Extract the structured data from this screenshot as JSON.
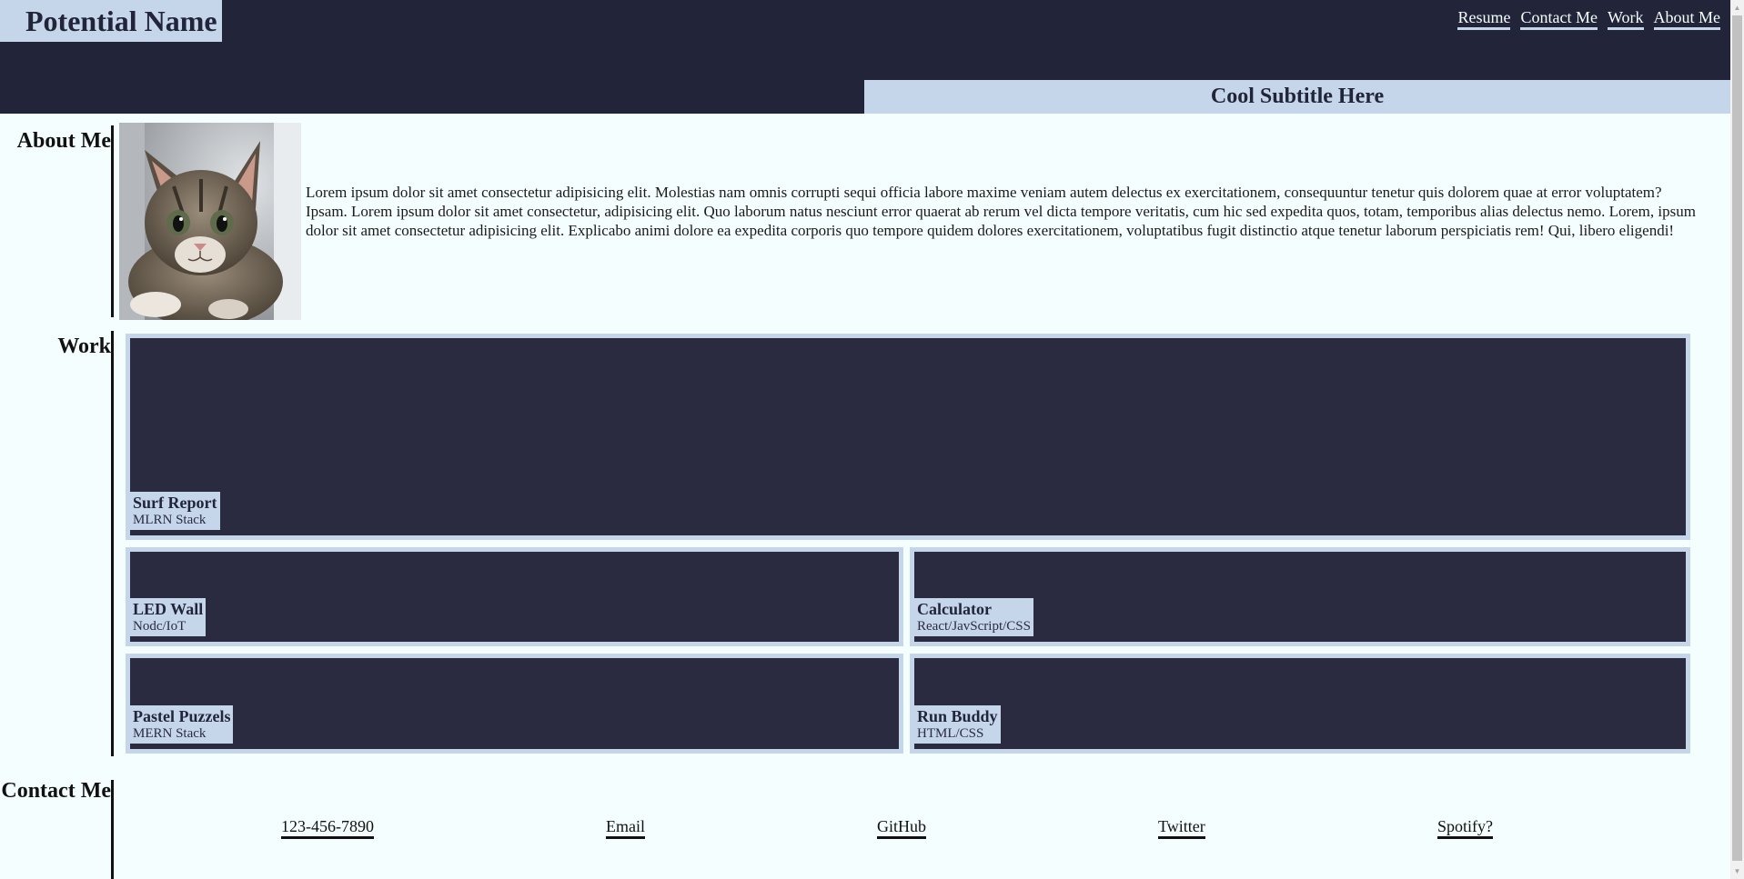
{
  "header": {
    "brand": "Potential Name",
    "nav": [
      "Resume",
      "Contact Me",
      "Work",
      "About Me"
    ],
    "subtitle": "Cool Subtitle Here"
  },
  "about": {
    "label": "About Me",
    "image_alt": "kitten-photo",
    "text": "Lorem ipsum dolor sit amet consectetur adipisicing elit. Molestias nam omnis corrupti sequi officia labore maxime veniam autem delectus ex exercitationem, consequuntur tenetur quis dolorem quae at error voluptatem? Ipsam. Lorem ipsum dolor sit amet consectetur, adipisicing elit. Quo laborum natus nesciunt error quaerat ab rerum vel dicta tempore veritatis, cum hic sed expedita quos, totam, temporibus alias delectus nemo. Lorem, ipsum dolor sit amet consectetur adipisicing elit. Explicabo animi dolore ea expedita corporis quo tempore quidem dolores exercitationem, voluptatibus fugit distinctio atque tenetur laborum perspiciatis rem! Qui, libero eligendi!"
  },
  "work": {
    "label": "Work",
    "projects": [
      {
        "title": "Surf Report",
        "stack": "MLRN Stack"
      },
      {
        "title": "LED Wall",
        "stack": "Nodc/IoT"
      },
      {
        "title": "Calculator",
        "stack": "React/JavScript/CSS"
      },
      {
        "title": "Pastel Puzzels",
        "stack": "MERN Stack"
      },
      {
        "title": "Run Buddy",
        "stack": "HTML/CSS"
      }
    ]
  },
  "contact": {
    "label": "Contact Me",
    "links": [
      "123-456-7890",
      "Email",
      "GitHub",
      "Twitter",
      "Spotify?"
    ]
  },
  "colors": {
    "navy": "#22253a",
    "card": "#2a2b40",
    "accent": "#c6d6ea",
    "background": "#f5fefe"
  }
}
